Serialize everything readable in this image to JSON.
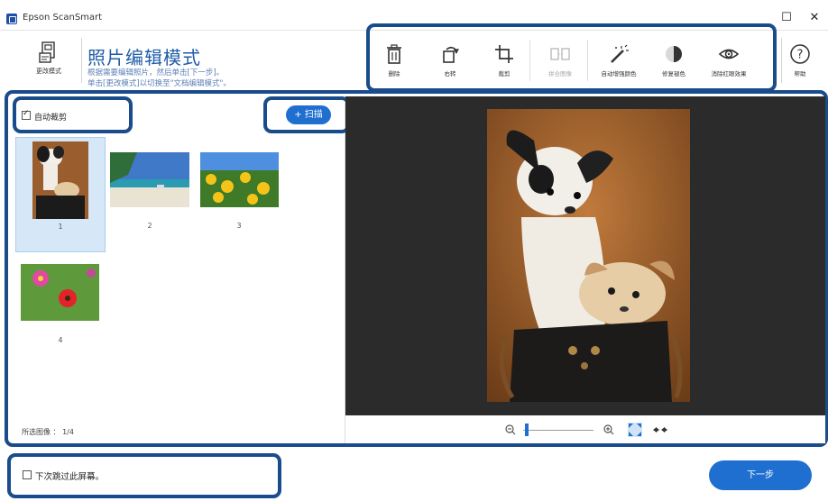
{
  "window": {
    "title": "Epson ScanSmart",
    "maximize_glyph": "☐",
    "close_glyph": "✕"
  },
  "header": {
    "change_mode_label": "更改模式",
    "mode_title": "照片编辑模式",
    "mode_desc_line1": "根据需要编辑照片，然后单击[下一步]。",
    "mode_desc_line2": "单击[更改模式]以切换至\"文档编辑模式\"。"
  },
  "toolbar": {
    "tools": [
      {
        "label": "删除",
        "icon": "trash-icon",
        "enabled": true
      },
      {
        "label": "右转",
        "icon": "rotate-right-icon",
        "enabled": true
      },
      {
        "label": "裁剪",
        "icon": "crop-icon",
        "enabled": true
      },
      {
        "label": "拼合图像",
        "icon": "merge-images-icon",
        "enabled": false
      },
      {
        "label": "自动增强颜色",
        "icon": "magic-wand-icon",
        "enabled": true
      },
      {
        "label": "修复褪色",
        "icon": "restore-fade-icon",
        "enabled": true
      },
      {
        "label": "消除红眼效果",
        "icon": "red-eye-icon",
        "enabled": true
      },
      {
        "label": "帮助",
        "icon": "help-icon",
        "enabled": true
      }
    ]
  },
  "left_panel": {
    "auto_crop": {
      "label": "自动裁剪",
      "checked": true
    },
    "scan_button": {
      "label": "+ 扫描"
    },
    "thumbnails": [
      {
        "number": "1",
        "subject": "dogs",
        "selected": true
      },
      {
        "number": "2",
        "subject": "beach",
        "selected": false
      },
      {
        "number": "3",
        "subject": "sunflowers",
        "selected": false
      },
      {
        "number": "4",
        "subject": "flowers",
        "selected": false
      }
    ],
    "selected_images": "所选图像 ： 1/4"
  },
  "zoom": {
    "level": 0.05
  },
  "footer": {
    "skip_label": "下次跳过此屏幕。",
    "skip_checked": false,
    "next_label": "下一步"
  }
}
